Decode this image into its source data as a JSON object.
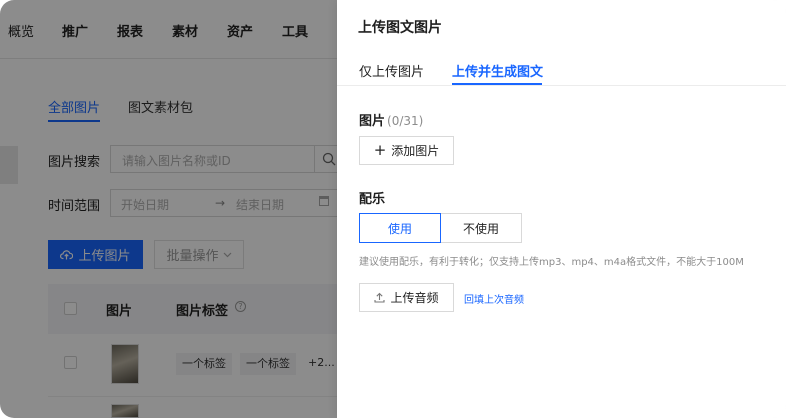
{
  "background": {
    "nav": [
      "概览",
      "推广",
      "报表",
      "素材",
      "资产",
      "工具"
    ],
    "subtabs": [
      "全部图片",
      "图文素材包"
    ],
    "search": {
      "label": "图片搜索",
      "placeholder": "请输入图片名称或ID"
    },
    "time_range": {
      "label": "时间范围",
      "start_placeholder": "开始日期",
      "end_placeholder": "结束日期"
    },
    "upload_image_button": "上传图片",
    "bulk_button": "批量操作",
    "table": {
      "headers": [
        "图片",
        "图片标签"
      ],
      "rows": [
        {
          "tags": [
            "一个标签",
            "一个标签"
          ],
          "more": "+2..."
        }
      ]
    }
  },
  "drawer": {
    "title": "上传图文图片",
    "tabs": [
      "仅上传图片",
      "上传并生成图文"
    ],
    "active_tab": 1,
    "images": {
      "label": "图片",
      "count": "(0/31)",
      "add_button": "添加图片"
    },
    "music": {
      "label": "配乐",
      "options": [
        "使用",
        "不使用"
      ],
      "selected": "使用",
      "hint": "建议使用配乐，有利于转化；仅支持上传mp3、mp4、m4a格式文件，不能大于100M",
      "upload_button": "上传音频",
      "reuse_link": "回填上次音频"
    }
  },
  "colors": {
    "accent": "#1966ff",
    "overlay": "rgba(0,0,0,0.45)"
  }
}
